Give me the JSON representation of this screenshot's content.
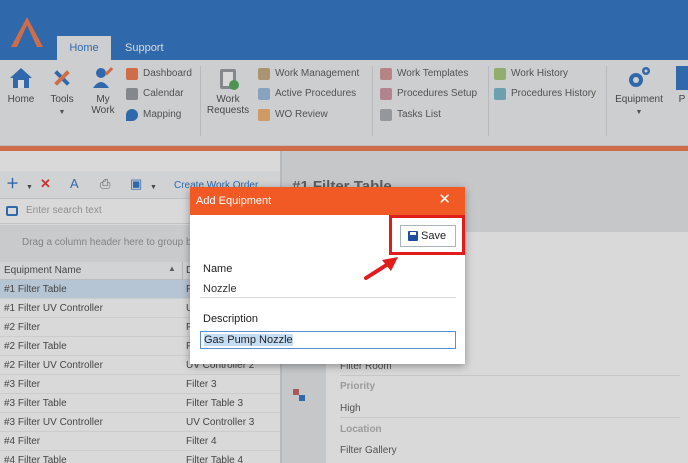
{
  "topbar": {
    "tabs": [
      "Home",
      "Support"
    ]
  },
  "ribbon": {
    "home_label": "Home",
    "tools_label": "Tools",
    "mywork_label": "My Work",
    "dashboard_label": "Dashboard",
    "calendar_label": "Calendar",
    "mapping_label": "Mapping",
    "work_requests_label": "Work Requests",
    "work_management_label": "Work Management",
    "active_procedures_label": "Active Procedures",
    "wo_review_label": "WO Review",
    "work_templates_label": "Work Templates",
    "procedures_setup_label": "Procedures Setup",
    "tasks_list_label": "Tasks List",
    "work_history_label": "Work History",
    "procedures_history_label": "Procedures History",
    "equipment_label": "Equipment",
    "partial_label": "P"
  },
  "left_panel": {
    "create_link": "Create Work Order",
    "search_placeholder": "Enter search text",
    "group_hint": "Drag a column header here to group b",
    "columns": [
      "Equipment Name",
      "D"
    ],
    "rows": [
      {
        "name": "#1 Filter Table",
        "desc": "F"
      },
      {
        "name": "#1 Filter UV Controller",
        "desc": "U"
      },
      {
        "name": "#2 Filter",
        "desc": "F"
      },
      {
        "name": "#2 Filter Table",
        "desc": "F"
      },
      {
        "name": "#2 Filter UV Controller",
        "desc": "UV Controller 2"
      },
      {
        "name": "#3 Filter",
        "desc": "Filter 3"
      },
      {
        "name": "#3 Filter Table",
        "desc": "Filter Table 3"
      },
      {
        "name": "#3 Filter UV Controller",
        "desc": "UV Controller 3"
      },
      {
        "name": "#4 Filter",
        "desc": "Filter 4"
      },
      {
        "name": "#4 Filter Table",
        "desc": "Filter Table 4"
      }
    ]
  },
  "right_panel": {
    "title": "#1 Filter Table",
    "room_value": "Filter Room",
    "priority_label": "Priority",
    "priority_value": "High",
    "location_label": "Location",
    "location_value": "Filter Gallery"
  },
  "dialog": {
    "title": "Add Equipment",
    "close_glyph": "✕",
    "save_label": "Save",
    "name_label": "Name",
    "name_value": "Nozzle",
    "description_label": "Description",
    "description_value": "Gas Pump Nozzle"
  },
  "colors": {
    "brand_blue": "#1565c0",
    "dialog_header": "#f15a24",
    "highlight_red": "#e21b1b"
  }
}
